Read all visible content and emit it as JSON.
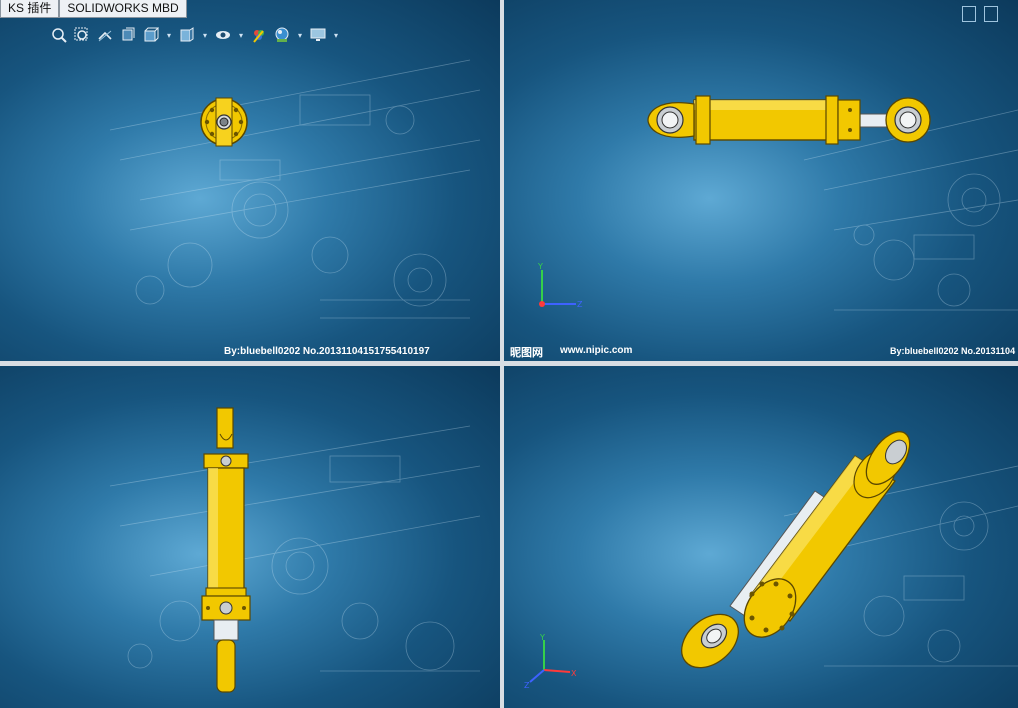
{
  "tabs": [
    {
      "label": "KS 插件"
    },
    {
      "label": "SOLIDWORKS MBD"
    }
  ],
  "toolbar": {
    "icons": [
      "zoom-to-fit-icon",
      "zoom-to-area-icon",
      "previous-view-icon",
      "section-view-icon",
      "view-orientation-icon",
      "display-style-icon",
      "hide-show-items-icon",
      "edit-appearance-icon",
      "apply-scene-icon",
      "view-settings-icon"
    ]
  },
  "viewports": {
    "top_left": {
      "name": "front-view"
    },
    "top_right": {
      "name": "top-view",
      "watermark": "By:bluebell0202  No.20131104",
      "triad_labels": {
        "y": "Y",
        "z": "Z"
      }
    },
    "bottom_left": {
      "name": "right-view"
    },
    "bottom_right": {
      "name": "isometric-view",
      "triad_labels": {
        "y": "Y",
        "x": "X",
        "z": "Z"
      }
    }
  },
  "watermarks": {
    "center_author": "By:bluebell0202  No.20131104151755410197",
    "site_cn": "昵图网",
    "site_url": "www.nipic.com"
  },
  "colors": {
    "cylinder_yellow": "#f2c800",
    "cylinder_shadow": "#b38f00",
    "rod_white": "#e8eef2",
    "background_blue": "#17557f"
  }
}
